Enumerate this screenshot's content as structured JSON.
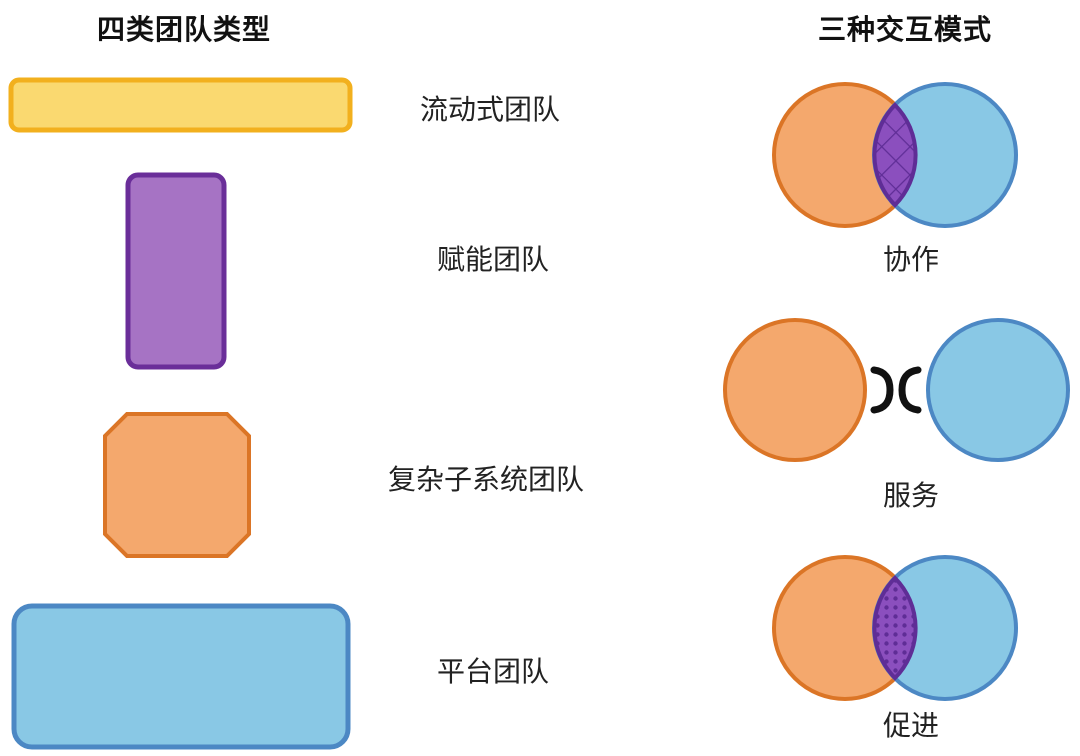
{
  "headings": {
    "team_types": "四类团队类型",
    "interaction_modes": "三种交互模式"
  },
  "team_types": [
    {
      "label": "流动式团队",
      "shape": "wide-bar",
      "fill": "#FAD970",
      "stroke": "#F2B01E"
    },
    {
      "label": "赋能团队",
      "shape": "tall-rectangle",
      "fill": "#A673C4",
      "stroke": "#6A2E99"
    },
    {
      "label": "复杂子系统团队",
      "shape": "octagon",
      "fill": "#F4A86D",
      "stroke": "#DB7526"
    },
    {
      "label": "平台团队",
      "shape": "large-rectangle",
      "fill": "#89C8E5",
      "stroke": "#4C88C4"
    }
  ],
  "interaction_modes": [
    {
      "label": "协作",
      "overlap_pattern": "crosshatch"
    },
    {
      "label": "服务",
      "connector": "bracket"
    },
    {
      "label": "促进",
      "overlap_pattern": "dots"
    }
  ],
  "colors": {
    "orange_fill": "#F4A86D",
    "orange_stroke": "#DB7526",
    "blue_fill": "#89C8E5",
    "blue_stroke": "#4C88C4",
    "purple_fill": "#8B4FBE",
    "purple_stroke": "#5F2D96"
  }
}
